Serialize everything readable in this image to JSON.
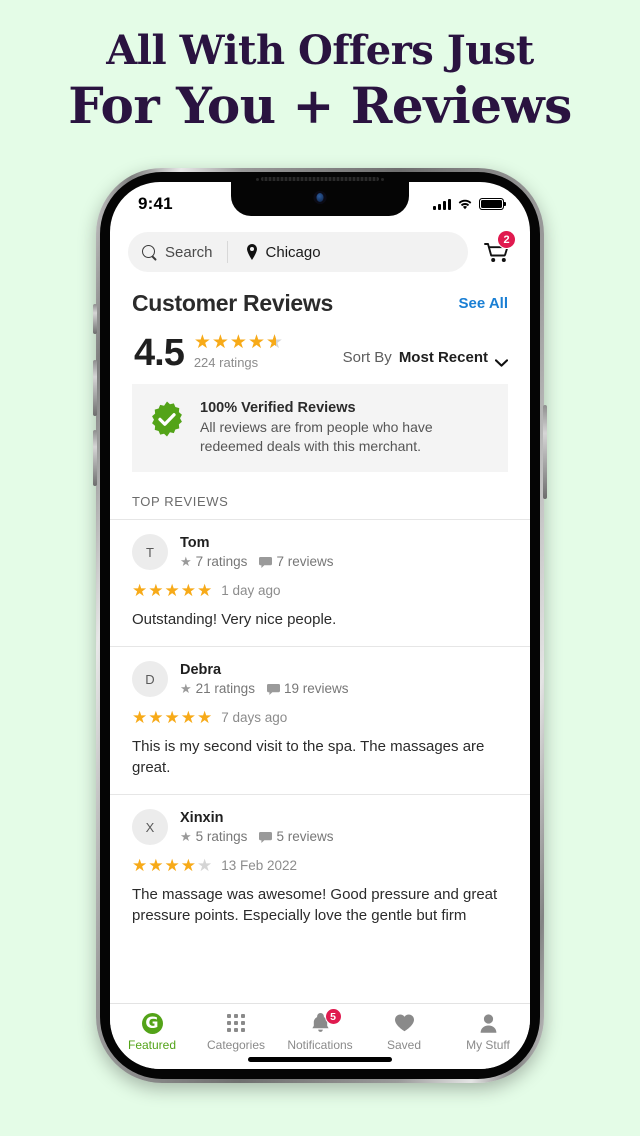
{
  "promo": {
    "line1": "All With Offers Just",
    "line2": "For You + Reviews",
    "background_color": "#E4FCE7",
    "text_color": "#2A1340"
  },
  "status_bar": {
    "time": "9:41",
    "signal_icon": "cellular-bars-icon",
    "wifi_icon": "wifi-icon",
    "battery_icon": "battery-full-icon"
  },
  "search": {
    "placeholder": "Search",
    "search_icon": "search-icon",
    "location_icon": "location-pin-icon",
    "location_value": "Chicago",
    "cart_icon": "shopping-cart-icon",
    "cart_badge": "2",
    "badge_color": "#E01A4F"
  },
  "section": {
    "title": "Customer Reviews",
    "see_all_label": "See All",
    "see_all_color": "#1A7FD4"
  },
  "rating_summary": {
    "score": "4.5",
    "stars_filled": 4,
    "stars_half": true,
    "ratings_count": "224 ratings",
    "star_color": "#F7AA18",
    "sort_label": "Sort By",
    "sort_value": "Most Recent",
    "chevron_icon": "chevron-down-icon"
  },
  "verified_banner": {
    "badge_icon": "verified-check-badge-icon",
    "badge_color": "#53A318",
    "title": "100% Verified Reviews",
    "subtitle": "All reviews are from people who have redeemed deals with this merchant."
  },
  "top_reviews_label": "TOP REVIEWS",
  "reviews": [
    {
      "avatar_initial": "T",
      "name": "Tom",
      "ratings": "7 ratings",
      "reviews": "7 reviews",
      "stars": 5,
      "date": "1 day ago",
      "text": "Outstanding! Very nice people."
    },
    {
      "avatar_initial": "D",
      "name": "Debra",
      "ratings": "21 ratings",
      "reviews": "19 reviews",
      "stars": 5,
      "date": "7 days ago",
      "text": "This is my second visit to the spa. The massages are great."
    },
    {
      "avatar_initial": "X",
      "name": "Xinxin",
      "ratings": "5 ratings",
      "reviews": "5 reviews",
      "stars": 4,
      "date": "13 Feb 2022",
      "text": "The massage was awesome! Good pressure and great pressure points. Especially love the gentle but firm"
    }
  ],
  "tab_bar": {
    "items": [
      {
        "label": "Featured",
        "icon": "groupon-g-logo-icon",
        "active": true,
        "badge": null
      },
      {
        "label": "Categories",
        "icon": "grid-icon",
        "active": false,
        "badge": null
      },
      {
        "label": "Notifications",
        "icon": "bell-icon",
        "active": false,
        "badge": "5"
      },
      {
        "label": "Saved",
        "icon": "heart-icon",
        "active": false,
        "badge": null
      },
      {
        "label": "My Stuff",
        "icon": "person-icon",
        "active": false,
        "badge": null
      }
    ],
    "active_color": "#53A318",
    "inactive_color": "#8A8A8A"
  }
}
